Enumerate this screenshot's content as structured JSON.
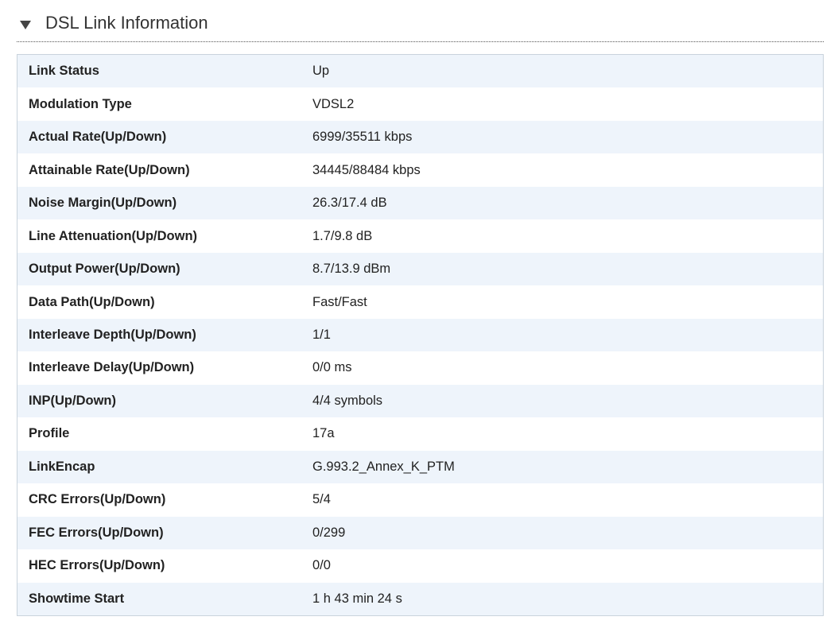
{
  "section": {
    "title": "DSL Link Information",
    "expanded": true
  },
  "rows": [
    {
      "label": "Link Status",
      "value": "Up"
    },
    {
      "label": "Modulation Type",
      "value": "VDSL2"
    },
    {
      "label": "Actual Rate(Up/Down)",
      "value": "6999/35511 kbps"
    },
    {
      "label": "Attainable Rate(Up/Down)",
      "value": "34445/88484 kbps"
    },
    {
      "label": "Noise Margin(Up/Down)",
      "value": "26.3/17.4 dB"
    },
    {
      "label": "Line Attenuation(Up/Down)",
      "value": "1.7/9.8 dB"
    },
    {
      "label": "Output Power(Up/Down)",
      "value": "8.7/13.9 dBm"
    },
    {
      "label": "Data Path(Up/Down)",
      "value": "Fast/Fast"
    },
    {
      "label": "Interleave Depth(Up/Down)",
      "value": "1/1"
    },
    {
      "label": "Interleave Delay(Up/Down)",
      "value": "0/0 ms"
    },
    {
      "label": "INP(Up/Down)",
      "value": "4/4 symbols"
    },
    {
      "label": "Profile",
      "value": "17a"
    },
    {
      "label": "LinkEncap",
      "value": "G.993.2_Annex_K_PTM"
    },
    {
      "label": "CRC Errors(Up/Down)",
      "value": "5/4"
    },
    {
      "label": "FEC Errors(Up/Down)",
      "value": "0/299"
    },
    {
      "label": "HEC Errors(Up/Down)",
      "value": "0/0"
    },
    {
      "label": "Showtime Start",
      "value": "1 h 43 min 24 s"
    }
  ]
}
